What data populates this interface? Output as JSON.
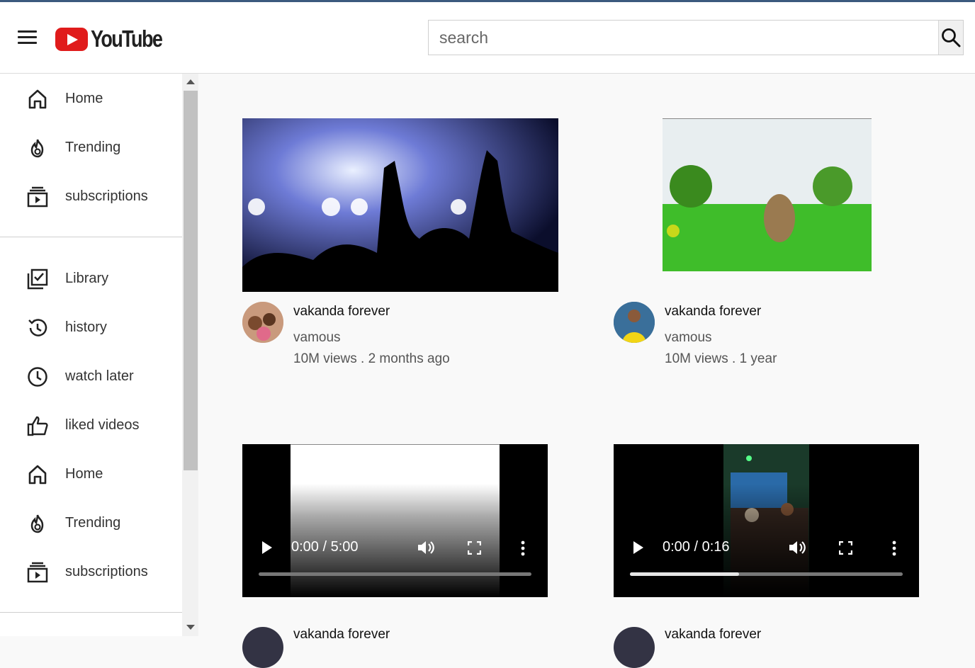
{
  "app": {
    "logo_text": "YouTube"
  },
  "search": {
    "placeholder": "search"
  },
  "sidebar": {
    "section1": [
      {
        "label": "Home",
        "icon": "home-icon"
      },
      {
        "label": "Trending",
        "icon": "flame-icon"
      },
      {
        "label": "subscriptions",
        "icon": "subscriptions-icon"
      }
    ],
    "section2": [
      {
        "label": "Library",
        "icon": "library-icon"
      },
      {
        "label": "history",
        "icon": "history-icon"
      },
      {
        "label": "watch later",
        "icon": "clock-icon"
      },
      {
        "label": "liked videos",
        "icon": "thumbs-up-icon"
      },
      {
        "label": "Home",
        "icon": "home-icon"
      },
      {
        "label": "Trending",
        "icon": "flame-icon"
      },
      {
        "label": "subscriptions",
        "icon": "subscriptions-icon"
      }
    ]
  },
  "videos": [
    {
      "title": "vakanda forever",
      "channel": "vamous",
      "meta": "10M views . 2 months ago"
    },
    {
      "title": "vakanda forever",
      "channel": "vamous",
      "meta": "10M views . 1 year"
    },
    {
      "title": "vakanda forever",
      "time": "0:00 / 5:00",
      "progress": 0
    },
    {
      "title": "vakanda forever",
      "time": "0:00 / 0:16",
      "progress": 0.4
    }
  ],
  "colors": {
    "brand_red": "#e01b1b",
    "accent_bar": "#3b5a7e"
  }
}
